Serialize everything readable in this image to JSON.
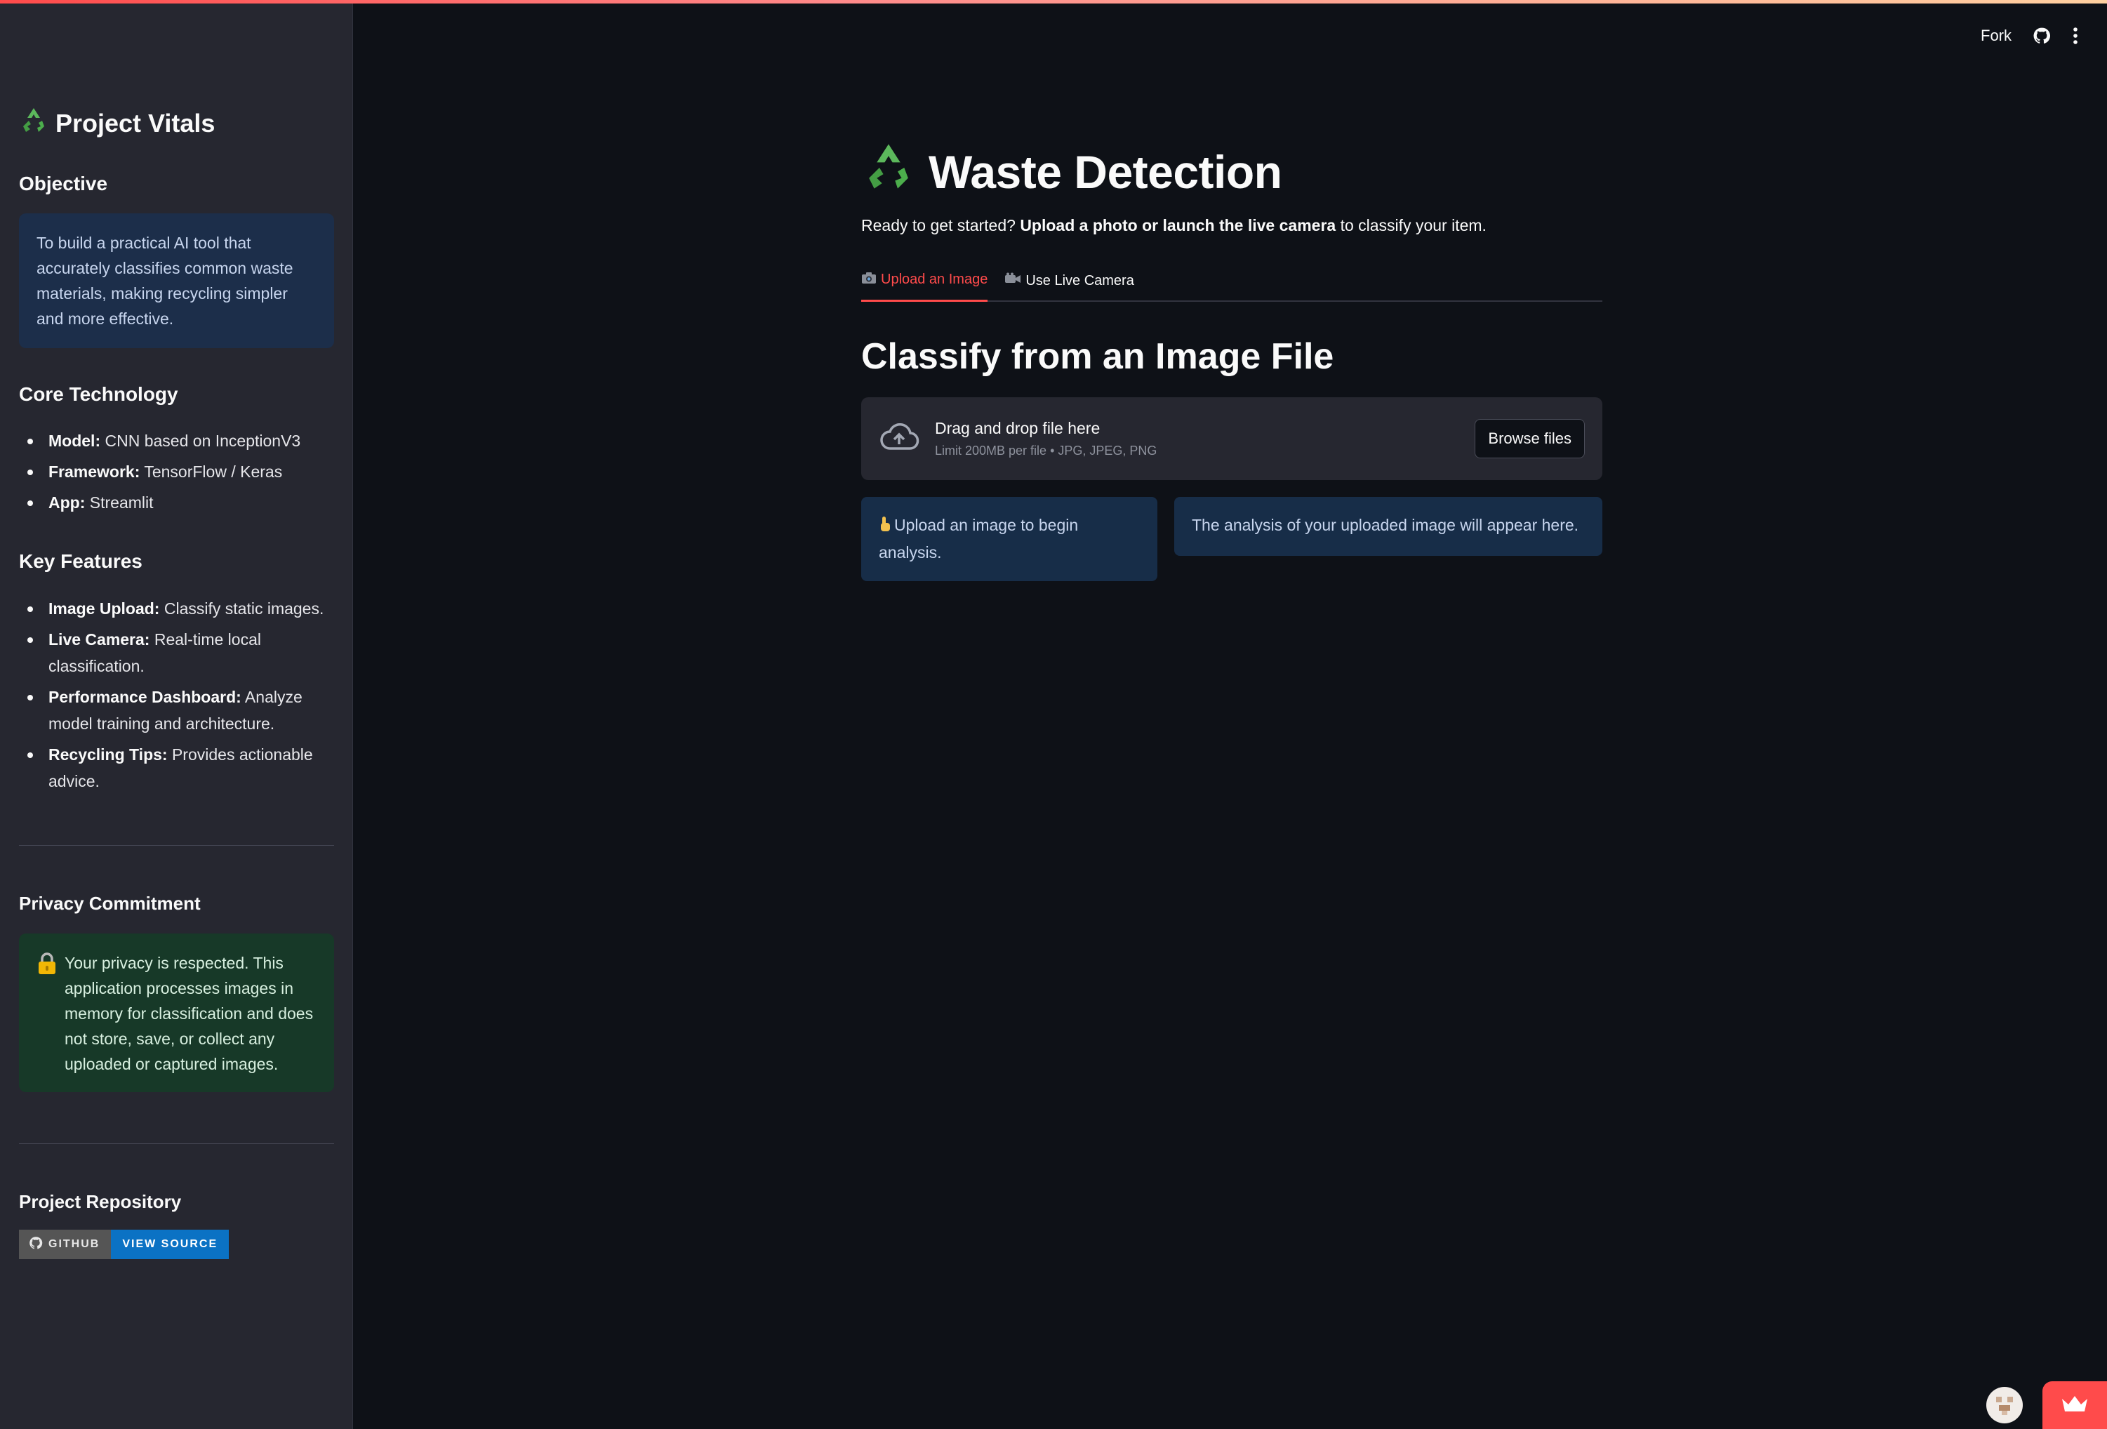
{
  "sidebar": {
    "title": "Project Vitals",
    "title_icon": "recycle-icon",
    "objective": {
      "heading": "Objective",
      "text": "To build a practical AI tool that accurately classifies common waste materials, making recycling simpler and more effective."
    },
    "core_technology": {
      "heading": "Core Technology",
      "items": [
        {
          "label": "Model:",
          "value": " CNN based on InceptionV3"
        },
        {
          "label": "Framework:",
          "value": " TensorFlow / Keras"
        },
        {
          "label": "App:",
          "value": " Streamlit"
        }
      ]
    },
    "key_features": {
      "heading": "Key Features",
      "items": [
        {
          "label": "Image Upload:",
          "value": " Classify static images."
        },
        {
          "label": "Live Camera:",
          "value": " Real-time local classification."
        },
        {
          "label": "Performance Dashboard:",
          "value": " Analyze model training and architecture."
        },
        {
          "label": "Recycling Tips:",
          "value": " Provides actionable advice."
        }
      ]
    },
    "privacy": {
      "heading": "Privacy Commitment",
      "icon": "lock-icon",
      "text": "Your privacy is respected. This application processes images in memory for classification and does not store, save, or collect any uploaded or captured images."
    },
    "repository": {
      "heading": "Project Repository",
      "badge_left": "GITHUB",
      "badge_right": "VIEW SOURCE"
    }
  },
  "header": {
    "fork_label": "Fork",
    "github_icon": "github-icon",
    "menu_icon": "kebab-menu-icon"
  },
  "main": {
    "title": "Waste Detection",
    "intro": {
      "prefix": "Ready to get started? ",
      "bold": "Upload a photo or launch the live camera",
      "suffix": " to classify your item."
    },
    "tabs": [
      {
        "label": "Upload an Image",
        "icon": "camera-icon",
        "active": true
      },
      {
        "label": "Use Live Camera",
        "icon": "video-camera-icon",
        "active": false
      }
    ],
    "section_title": "Classify from an Image File",
    "uploader": {
      "primary": "Drag and drop file here",
      "secondary": "Limit 200MB per file • JPG, JPEG, PNG",
      "button": "Browse files"
    },
    "info_left": "Upload an image to begin analysis.",
    "info_right": "The analysis of your uploaded image will appear here."
  },
  "colors": {
    "accent": "#ff4b4b",
    "background": "#0e1117",
    "sidebar": "#262730",
    "info_blue": "#172d48",
    "success_green": "#173928",
    "badge_blue": "#0b72c4"
  }
}
